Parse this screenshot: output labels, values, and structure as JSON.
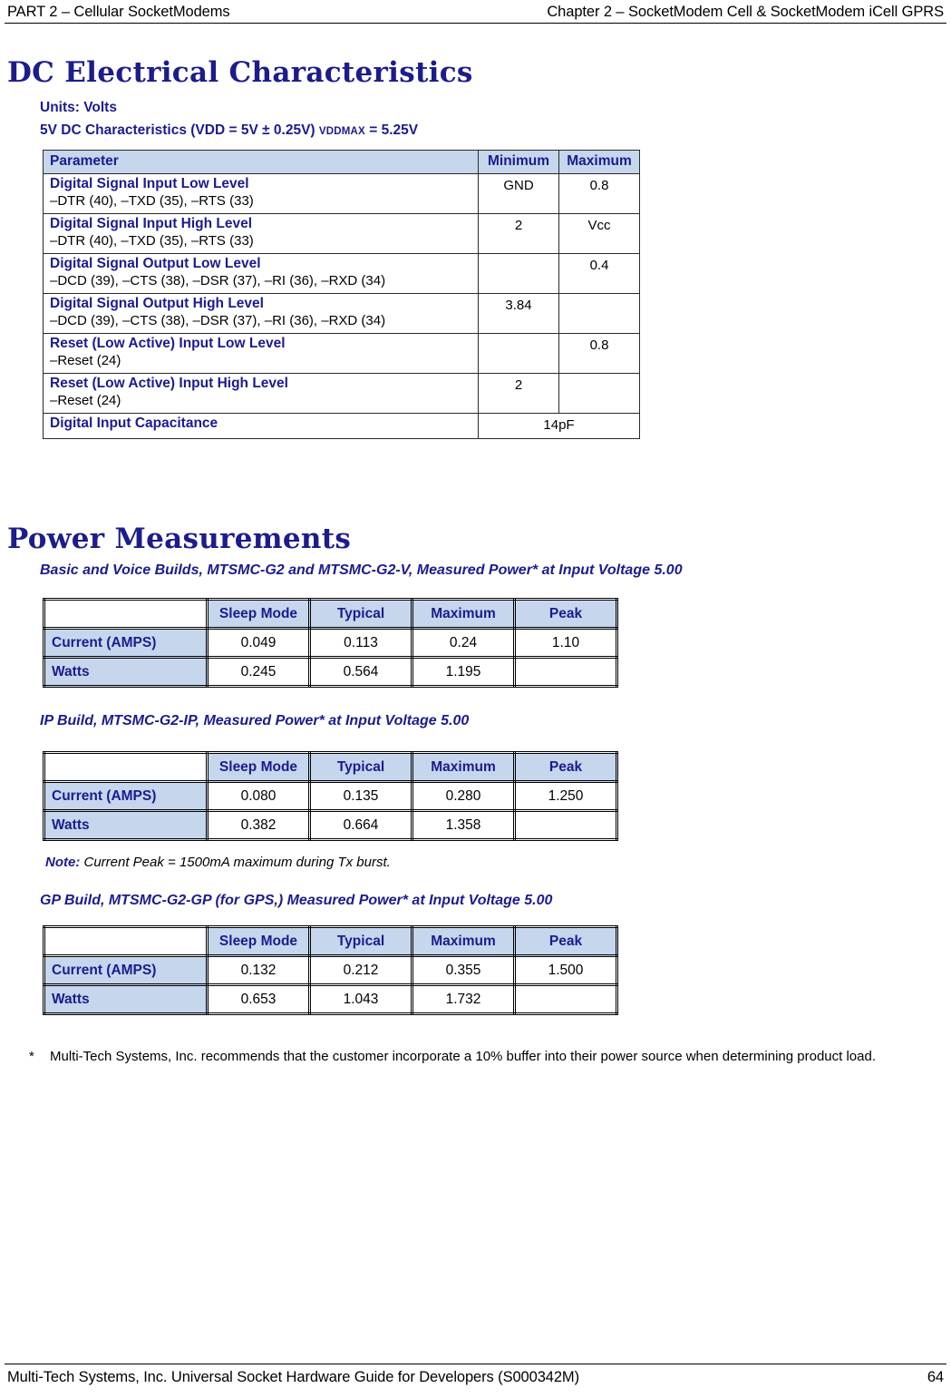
{
  "running_head": {
    "left": "PART 2 – Cellular SocketModems",
    "right": "Chapter 2 – SocketModem Cell & SocketModem iCell GPRS"
  },
  "sections": {
    "dc": {
      "title": "DC Electrical Characteristics",
      "units_line": "Units: Volts",
      "characteristics_line": "5V DC Characteristics (VDD = 5V ± 0.25V)",
      "characteristics_sub": "VDDMAX",
      "characteristics_tail": "= 5.25V"
    },
    "power": {
      "title": "Power Measurements",
      "basic_heading": "Basic and Voice Builds, MTSMC-G2 and MTSMC-G2-V, Measured Power* at Input Voltage 5.00",
      "ip_heading": "IP Build, MTSMC-G2-IP, Measured Power* at Input Voltage 5.00",
      "gp_heading": "GP Build, MTSMC-G2-GP (for GPS,) Measured Power* at Input Voltage 5.00",
      "note_label": "Note:",
      "note_text": " Current Peak = 1500mA maximum during Tx burst."
    }
  },
  "dc_table": {
    "headers": [
      "Parameter",
      "Minimum",
      "Maximum"
    ],
    "rows": [
      {
        "name": "Digital Signal Input Low Level",
        "pins": "–DTR (40), –TXD (35), –RTS (33)",
        "minimum": "GND",
        "maximum": "0.8"
      },
      {
        "name": "Digital Signal Input High Level",
        "pins": "–DTR (40), –TXD (35), –RTS (33)",
        "minimum": "2",
        "maximum": "Vcc"
      },
      {
        "name": "Digital Signal Output Low Level",
        "pins": "–DCD (39), –CTS (38), –DSR (37), –RI (36), –RXD (34)",
        "minimum": "",
        "maximum": "0.4"
      },
      {
        "name": "Digital Signal Output High Level",
        "pins": "–DCD (39), –CTS (38), –DSR (37), –RI (36), –RXD (34)",
        "minimum": "3.84",
        "maximum": ""
      },
      {
        "name": "Reset (Low Active) Input Low Level",
        "pins": "–Reset (24)",
        "minimum": "",
        "maximum": "0.8"
      },
      {
        "name": "Reset (Low Active) Input High Level",
        "pins": "–Reset (24)",
        "minimum": "2",
        "maximum": ""
      }
    ],
    "capacitance_row": {
      "name": "Digital Input Capacitance",
      "value": "14pF"
    }
  },
  "power_tables": {
    "headers": [
      "",
      "Sleep Mode",
      "Typical",
      "Maximum",
      "Peak"
    ],
    "basic": {
      "current_label": "Current (AMPS)",
      "current": [
        "0.049",
        "0.113",
        "0.24",
        "1.10"
      ],
      "watts_label": "Watts",
      "watts": [
        "0.245",
        "0.564",
        "1.195",
        ""
      ]
    },
    "ip": {
      "current_label": "Current (AMPS)",
      "current": [
        "0.080",
        "0.135",
        "0.280",
        "1.250"
      ],
      "watts_label": "Watts",
      "watts": [
        "0.382",
        "0.664",
        "1.358",
        ""
      ]
    },
    "gp": {
      "current_label": "Current (AMPS)",
      "current": [
        "0.132",
        "0.212",
        "0.355",
        "1.500"
      ],
      "watts_label": "Watts",
      "watts": [
        "0.653",
        "1.043",
        "1.732",
        ""
      ]
    }
  },
  "footnote": {
    "marker": "*",
    "text": "Multi-Tech Systems, Inc. recommends that the customer incorporate a 10% buffer into their power source when determining product load."
  },
  "footer": {
    "left": "Multi-Tech Systems, Inc. Universal Socket Hardware Guide for Developers (S000342M)",
    "page": "64"
  },
  "colors": {
    "heading_blue": "#1c1c8c",
    "table_header_bg": "#c6d6ec",
    "text_black": "#000000"
  }
}
